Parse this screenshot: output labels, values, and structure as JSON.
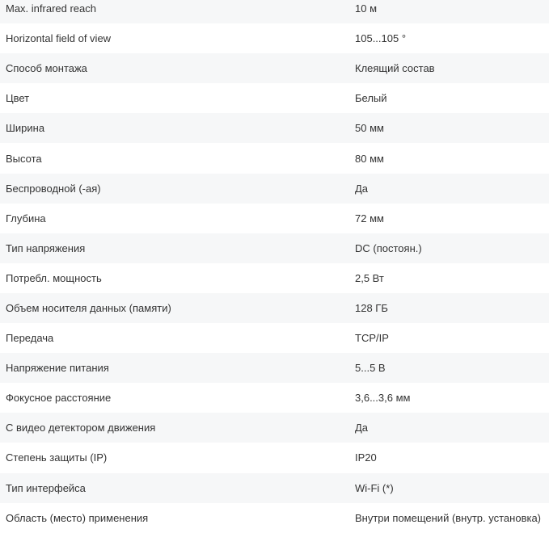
{
  "specs": [
    {
      "name": "Max. infrared reach",
      "value": "10 м"
    },
    {
      "name": "Horizontal field of view",
      "value": "105...105 °"
    },
    {
      "name": "Способ монтажа",
      "value": "Клеящий состав"
    },
    {
      "name": "Цвет",
      "value": "Белый"
    },
    {
      "name": "Ширина",
      "value": "50 мм"
    },
    {
      "name": "Высота",
      "value": "80 мм"
    },
    {
      "name": "Беспроводной (-ая)",
      "value": "Да"
    },
    {
      "name": "Глубина",
      "value": "72 мм"
    },
    {
      "name": "Тип напряжения",
      "value": "DC (постоян.)"
    },
    {
      "name": "Потребл. мощность",
      "value": "2,5 Вт"
    },
    {
      "name": "Объем носителя данных (памяти)",
      "value": "128 ГБ"
    },
    {
      "name": "Передача",
      "value": "TCP/IP"
    },
    {
      "name": "Напряжение питания",
      "value": "5...5 В"
    },
    {
      "name": "Фокусное расстояние",
      "value": "3,6...3,6 мм"
    },
    {
      "name": "С видео детектором движения",
      "value": "Да"
    },
    {
      "name": "Степень защиты (IP)",
      "value": "IP20"
    },
    {
      "name": "Тип интерфейса",
      "value": "Wi-Fi (*)"
    },
    {
      "name": "Область (место) применения",
      "value": "Внутри помещений (внутр. установка)"
    }
  ]
}
